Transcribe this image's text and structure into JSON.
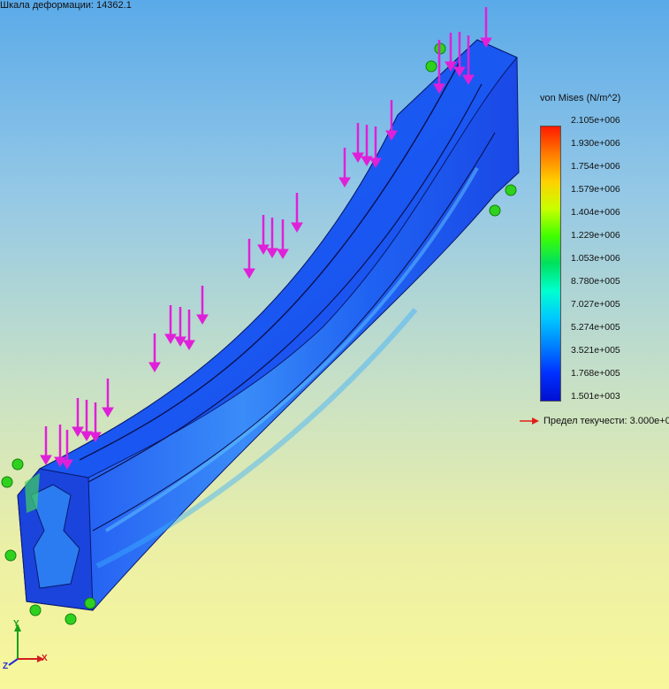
{
  "header": {
    "deformation_scale": "Шкала деформации: 14362.1"
  },
  "legend": {
    "title": "von Mises (N/m^2)",
    "colors": [
      "#ff1a00",
      "#ff7a00",
      "#ffd000",
      "#c8ff00",
      "#40ff00",
      "#00e060",
      "#00ffd0",
      "#00c8ff",
      "#0080ff",
      "#0030ff",
      "#0010d0"
    ],
    "ticks": [
      "2.105e+006",
      "1.930e+006",
      "1.754e+006",
      "1.579e+006",
      "1.404e+006",
      "1.229e+006",
      "1.053e+006",
      "8.780e+005",
      "7.027e+005",
      "5.274e+005",
      "3.521e+005",
      "1.768e+005",
      "1.501e+003"
    ],
    "yield_label": "Предел текучести: 3.000e+0",
    "yield_arrow_color": "#e0201a"
  },
  "triad": {
    "x": "X",
    "y": "Y",
    "z": "Z"
  },
  "colors": {
    "load_arrow": "#e020d8",
    "fixture": "#2ed21e",
    "beam": "#1e4cf0"
  }
}
